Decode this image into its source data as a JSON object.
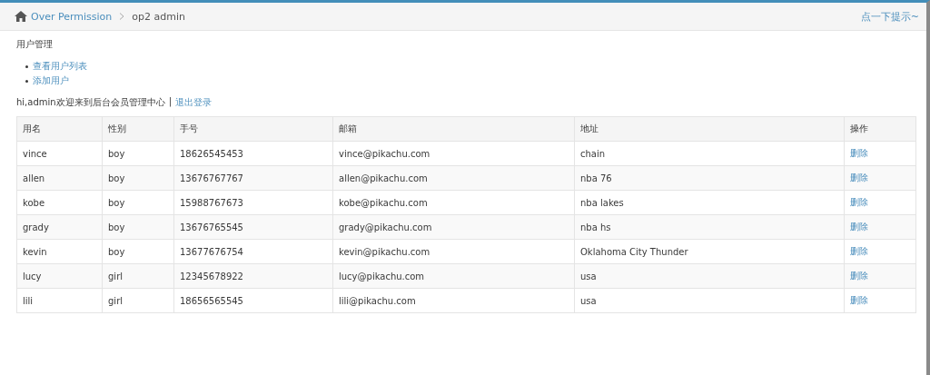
{
  "breadcrumb": {
    "items": [
      {
        "label": "Over Permission",
        "kind": "link"
      },
      {
        "label": "op2 admin",
        "kind": "current"
      }
    ],
    "hint": "点一下提示~"
  },
  "section_title": "用户管理",
  "menu": [
    "查看用户列表",
    "添加用户"
  ],
  "welcome": {
    "text": "hi,admin欢迎来到后台会员管理中心",
    "separator": "|",
    "logout": "退出登录"
  },
  "table": {
    "columns": [
      "用名",
      "性别",
      "手号",
      "邮箱",
      "地址",
      "操作"
    ],
    "rows": [
      {
        "cells": [
          "vince",
          "boy",
          "18626545453",
          "vince@pikachu.com",
          "chain"
        ],
        "action": "删除"
      },
      {
        "cells": [
          "allen",
          "boy",
          "13676767767",
          "allen@pikachu.com",
          "nba 76"
        ],
        "action": "删除"
      },
      {
        "cells": [
          "kobe",
          "boy",
          "15988767673",
          "kobe@pikachu.com",
          "nba lakes"
        ],
        "action": "删除"
      },
      {
        "cells": [
          "grady",
          "boy",
          "13676765545",
          "grady@pikachu.com",
          "nba hs"
        ],
        "action": "删除"
      },
      {
        "cells": [
          "kevin",
          "boy",
          "13677676754",
          "kevin@pikachu.com",
          "Oklahoma City Thunder"
        ],
        "action": "删除"
      },
      {
        "cells": [
          "lucy",
          "girl",
          "12345678922",
          "lucy@pikachu.com",
          "usa"
        ],
        "action": "删除"
      },
      {
        "cells": [
          "lili",
          "girl",
          "18656565545",
          "lili@pikachu.com",
          "usa"
        ],
        "action": "删除"
      }
    ]
  }
}
